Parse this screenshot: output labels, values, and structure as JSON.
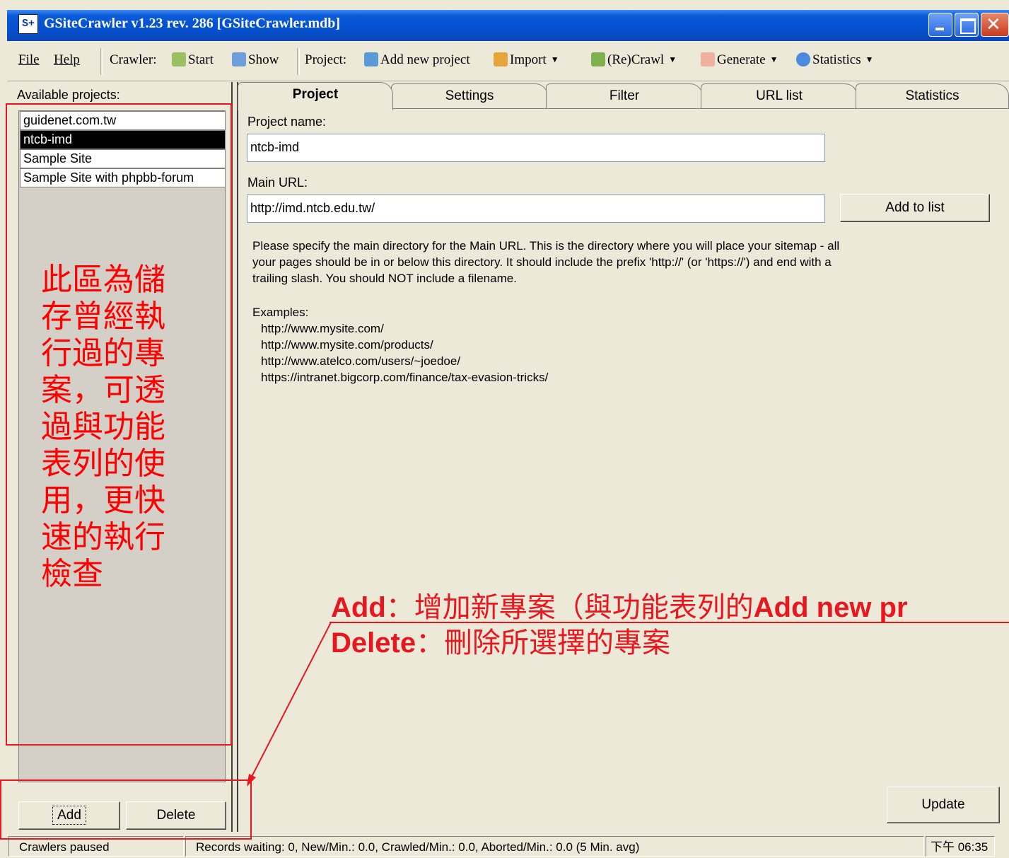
{
  "window": {
    "title": "GSiteCrawler v1.23 rev. 286 [GSiteCrawler.mdb]",
    "app_icon": "S+"
  },
  "toolbar": {
    "file": "File",
    "help": "Help",
    "crawler_label": "Crawler:",
    "start": "Start",
    "show": "Show",
    "project_label": "Project:",
    "add_new_project": "Add new project",
    "import": "Import",
    "recrawl": "(Re)Crawl",
    "generate": "Generate",
    "statistics": "Statistics"
  },
  "sidebar": {
    "label": "Available projects:",
    "projects": [
      "guidenet.com.tw",
      "ntcb-imd",
      "Sample Site",
      "Sample Site with phpbb-forum"
    ],
    "selected_index": 1,
    "add_button": "Add",
    "delete_button": "Delete"
  },
  "tabs": [
    "Project",
    "Settings",
    "Filter",
    "URL list",
    "Statistics"
  ],
  "active_tab": "Project",
  "project_form": {
    "name_label": "Project name:",
    "name_value": "ntcb-imd",
    "url_label": "Main URL:",
    "url_value": "http://imd.ntcb.edu.tw/",
    "add_to_list": "Add to list",
    "help_text": "Please specify the main directory for the Main URL. This is the directory where you will place your sitemap - all your pages should be in or below this directory. It should include the prefix 'http://' (or 'https://') and end with a trailing slash.  You should NOT include a filename.",
    "examples_label": "Examples:",
    "examples": [
      "http://www.mysite.com/",
      "http://www.mysite.com/products/",
      "http://www.atelco.com/users/~joedoe/",
      "https://intranet.bigcorp.com/finance/tax-evasion-tricks/"
    ],
    "update_button": "Update"
  },
  "statusbar": {
    "crawler_status": "Crawlers paused",
    "records": "Records waiting: 0, New/Min.: 0.0, Crawled/Min.: 0.0, Aborted/Min.: 0.0 (5 Min. avg)",
    "clock": "下午 06:35"
  },
  "annotations": {
    "left_note": "此區為儲存曾經執行過的專案，可透過與功能表列的使用，更快速的執行檢查",
    "add_label": "Add",
    "add_desc": "：增加新專案（與功能表列的",
    "add_ref": "Add new pr",
    "delete_label": "Delete",
    "delete_desc": "：刪除所選擇的專案"
  },
  "colors": {
    "annotation_red": "#e8161e",
    "titlebar_blue": "#0450d0",
    "window_face": "#ece9d8"
  }
}
